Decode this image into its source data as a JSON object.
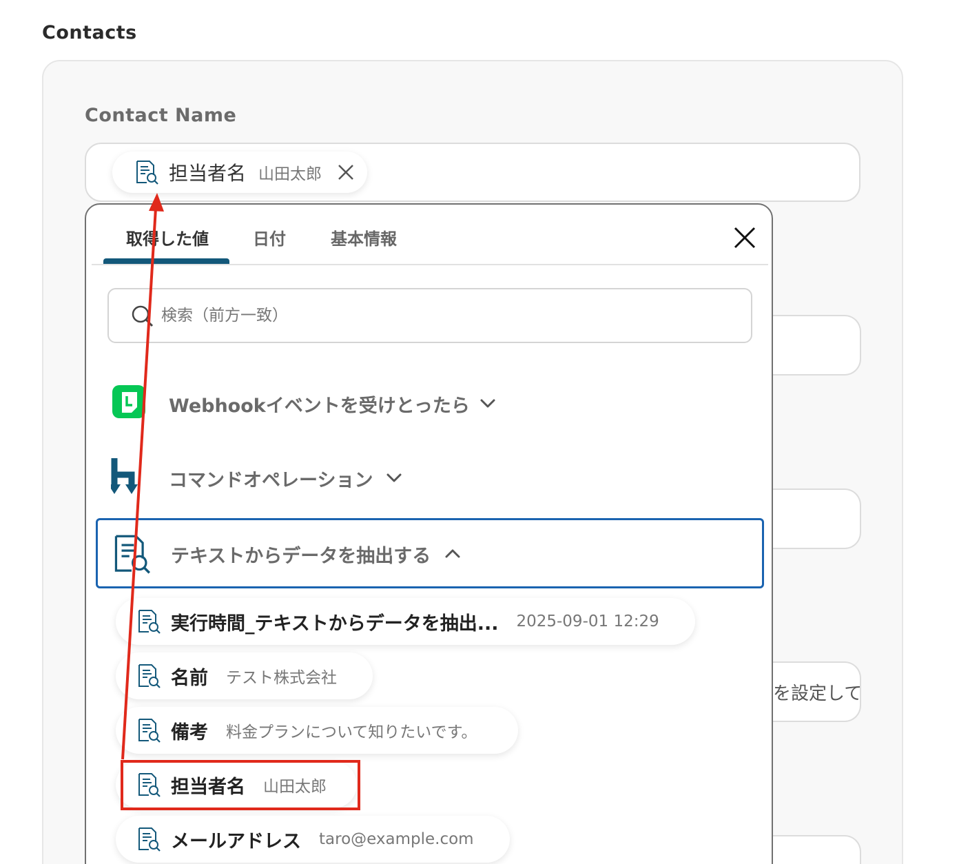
{
  "section_title": "Contacts",
  "field": {
    "label": "Contact Name",
    "selected_chip": {
      "key": "担当者名",
      "value": "山田太郎"
    }
  },
  "background_fields": [
    {
      "text": ""
    },
    {
      "text": ""
    },
    {
      "text": "を設定して"
    },
    {
      "text": ""
    }
  ],
  "dropdown": {
    "tabs": [
      {
        "label": "取得した値",
        "active": true
      },
      {
        "label": "日付",
        "active": false
      },
      {
        "label": "基本情報",
        "active": false
      }
    ],
    "search_placeholder": "検索（前方一致）",
    "groups": [
      {
        "label": "Webhookイベントを受けとったら",
        "icon": "line-app-icon",
        "expanded": false
      },
      {
        "label": "コマンドオペレーション",
        "icon": "command-operation-icon",
        "expanded": false
      },
      {
        "label": "テキストからデータを抽出する",
        "icon": "text-extract-icon",
        "expanded": true
      }
    ],
    "items": [
      {
        "key": "実行時間_テキストからデータを抽出...",
        "value": "2025-09-01 12:29"
      },
      {
        "key": "名前",
        "value": "テスト株式会社"
      },
      {
        "key": "備考",
        "value": "料金プランについて知りたいです。"
      },
      {
        "key": "担当者名",
        "value": "山田太郎",
        "highlighted": true
      },
      {
        "key": "メールアドレス",
        "value": "taro@example.com"
      }
    ]
  },
  "colors": {
    "accent": "#13587a",
    "focus_border": "#1a63b0",
    "annotation": "#e0291b",
    "line_green": "#06c755"
  }
}
